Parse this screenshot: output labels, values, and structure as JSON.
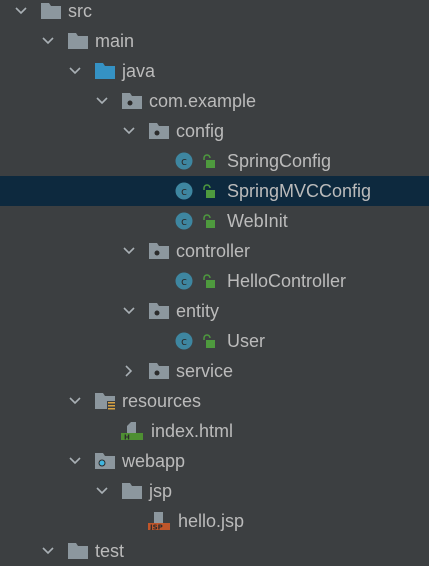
{
  "tree": [
    {
      "label": "src",
      "level": 0,
      "type": "folder",
      "expanded": true
    },
    {
      "label": "main",
      "level": 1,
      "type": "folder",
      "expanded": true
    },
    {
      "label": "java",
      "level": 2,
      "type": "source-folder",
      "expanded": true
    },
    {
      "label": "com.example",
      "level": 3,
      "type": "package",
      "expanded": true
    },
    {
      "label": "config",
      "level": 4,
      "type": "package",
      "expanded": true
    },
    {
      "label": "SpringConfig",
      "level": 5,
      "type": "class"
    },
    {
      "label": "SpringMVCConfig",
      "level": 5,
      "type": "class",
      "selected": true
    },
    {
      "label": "WebInit",
      "level": 5,
      "type": "class"
    },
    {
      "label": "controller",
      "level": 4,
      "type": "package",
      "expanded": true
    },
    {
      "label": "HelloController",
      "level": 5,
      "type": "class"
    },
    {
      "label": "entity",
      "level": 4,
      "type": "package",
      "expanded": true
    },
    {
      "label": "User",
      "level": 5,
      "type": "class"
    },
    {
      "label": "service",
      "level": 4,
      "type": "package",
      "expanded": false
    },
    {
      "label": "resources",
      "level": 2,
      "type": "resources-folder",
      "expanded": true
    },
    {
      "label": "index.html",
      "level": 3,
      "type": "html-file"
    },
    {
      "label": "webapp",
      "level": 2,
      "type": "web-folder",
      "expanded": true
    },
    {
      "label": "jsp",
      "level": 3,
      "type": "folder",
      "expanded": true
    },
    {
      "label": "hello.jsp",
      "level": 4,
      "type": "jsp-file"
    },
    {
      "label": "test",
      "level": 1,
      "type": "folder",
      "expanded": true
    }
  ],
  "colors": {
    "background": "#3c3f41",
    "selected": "#0d293e",
    "text": "#bbbbbb",
    "folder": "#8c979e",
    "source": "#3592c4",
    "class": "#3e86a0",
    "lock": "#4e9a3e",
    "html": "#4e8f32",
    "jsp": "#c0562a"
  }
}
